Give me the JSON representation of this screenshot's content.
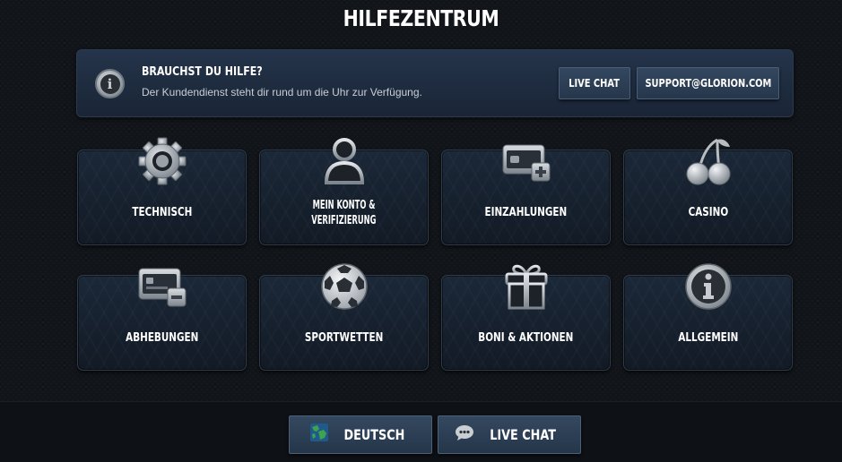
{
  "page": {
    "title": "HILFEZENTRUM"
  },
  "help_banner": {
    "icon": "info-icon",
    "title": "BRAUCHST DU HILFE?",
    "subtitle": "Der Kundendienst steht dir rund um die Uhr zur Verfügung.",
    "live_chat_label": "LIVE CHAT",
    "support_email": "SUPPORT@GLORION.COM"
  },
  "categories": [
    {
      "label_line1": "TECHNISCH",
      "label_line2": "",
      "icon": "gear-icon"
    },
    {
      "label_line1": "MEIN KONTO &",
      "label_line2": "VERIFIZIERUNG",
      "icon": "user-icon"
    },
    {
      "label_line1": "EINZAHLUNGEN",
      "label_line2": "",
      "icon": "wallet-plus-icon"
    },
    {
      "label_line1": "CASINO",
      "label_line2": "",
      "icon": "cherries-icon"
    },
    {
      "label_line1": "ABHEBUNGEN",
      "label_line2": "",
      "icon": "card-minus-icon"
    },
    {
      "label_line1": "SPORTWETTEN",
      "label_line2": "",
      "icon": "soccer-ball-icon"
    },
    {
      "label_line1": "BONI & AKTIONEN",
      "label_line2": "",
      "icon": "gift-icon"
    },
    {
      "label_line1": "ALLGEMEIN",
      "label_line2": "",
      "icon": "info-icon"
    }
  ],
  "footer": {
    "language_label": "DEUTSCH",
    "language_icon": "globe-icon",
    "live_chat_label": "LIVE CHAT",
    "live_chat_icon": "chat-bubble-icon"
  },
  "colors": {
    "background": "#111419",
    "banner": "#1f2d40",
    "tile": "#172230",
    "button": "#2d4057",
    "text": "#ffffff",
    "subtext": "#c7ced7",
    "icon_gray": "#a8adb2",
    "globe_green": "#3fa34d"
  }
}
